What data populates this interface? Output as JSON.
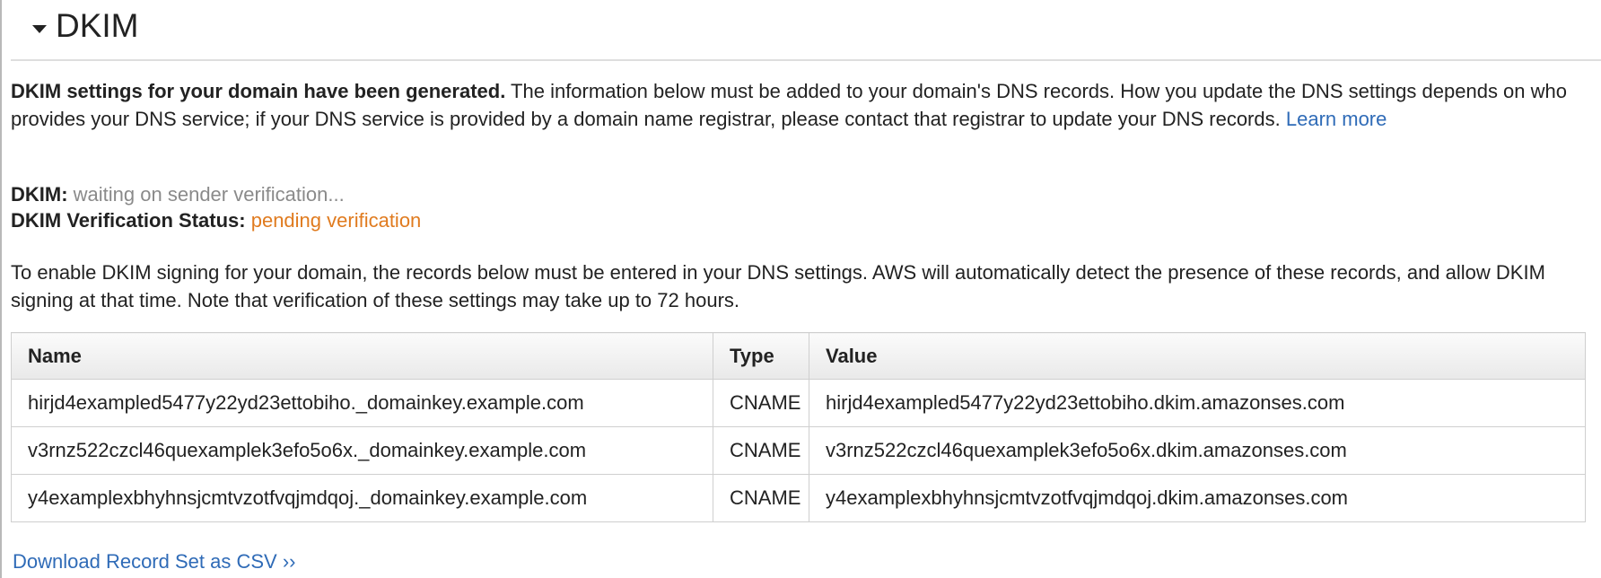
{
  "section": {
    "title": "DKIM"
  },
  "intro": {
    "bold": "DKIM settings for your domain have been generated.",
    "text": " The information below must be added to your domain's DNS records. How you update the DNS settings depends on who provides your DNS service; if your DNS service is provided by a domain name registrar, please contact that registrar to update your DNS records.",
    "link": "Learn more"
  },
  "status": {
    "dkim_label": "DKIM:",
    "dkim_value": "waiting on sender verification...",
    "verification_label": "DKIM Verification Status:",
    "verification_value": "pending verification"
  },
  "instructions": "To enable DKIM signing for your domain, the records below must be entered in your DNS settings. AWS will automatically detect the presence of these records, and allow DKIM signing at that time. Note that verification of these settings may take up to 72 hours.",
  "table": {
    "headers": [
      "Name",
      "Type",
      "Value"
    ],
    "rows": [
      [
        "hirjd4exampled5477y22yd23ettobiho._domainkey.example.com",
        "CNAME",
        "hirjd4exampled5477y22yd23ettobiho.dkim.amazonses.com"
      ],
      [
        "v3rnz522czcl46quexamplek3efo5o6x._domainkey.example.com",
        "CNAME",
        "v3rnz522czcl46quexamplek3efo5o6x.dkim.amazonses.com"
      ],
      [
        "y4examplexbhyhnsjcmtvzotfvqjmdqoj._domainkey.example.com",
        "CNAME",
        "y4examplexbhyhnsjcmtvzotfvqjmdqoj.dkim.amazonses.com"
      ]
    ]
  },
  "download": {
    "label": "Download Record Set as CSV ››"
  },
  "colors": {
    "link": "#2f6bb7",
    "pending": "#e07b1f",
    "muted": "#8a8a8a"
  },
  "icons": {
    "toggle": "caret-down-icon"
  }
}
